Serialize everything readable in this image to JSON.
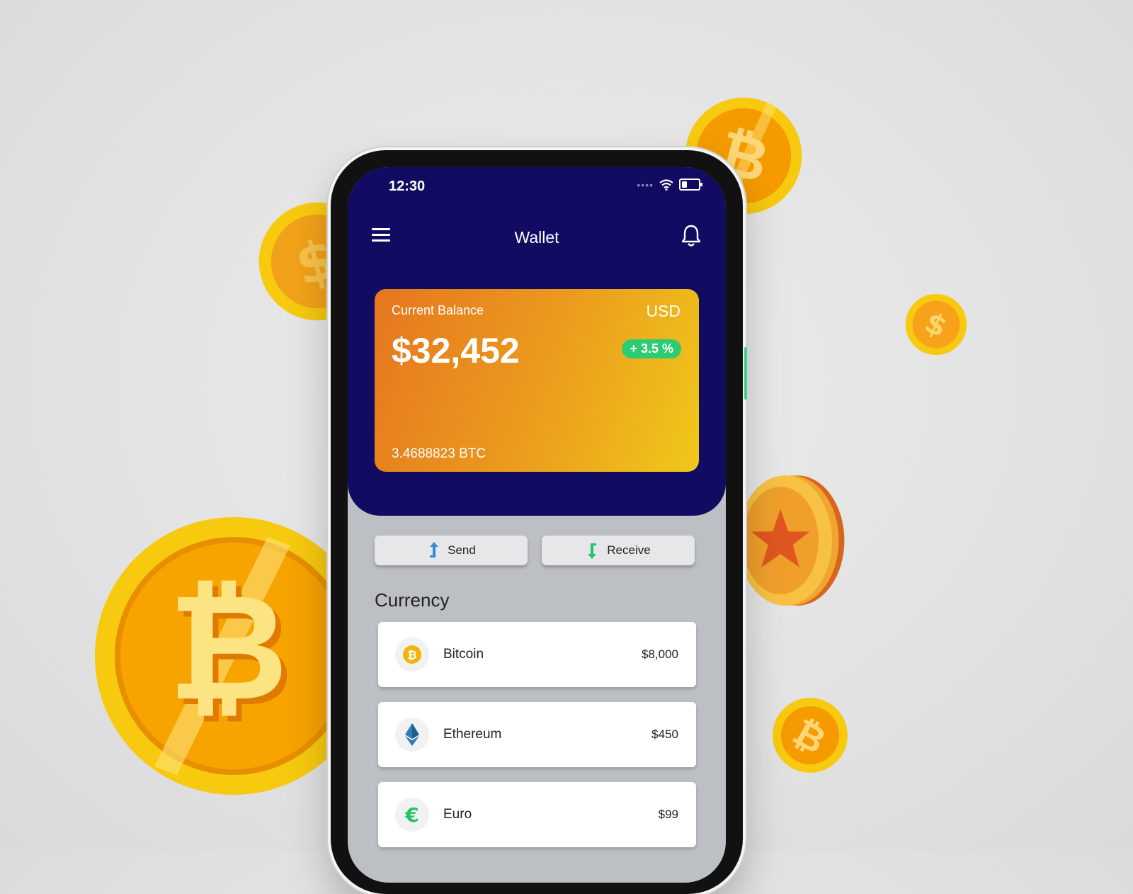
{
  "status_bar": {
    "time": "12:30"
  },
  "header": {
    "title": "Wallet"
  },
  "balance_card": {
    "label": "Current Balance",
    "currency": "USD",
    "amount": "$32,452",
    "change": "+ 3.5 %",
    "btc_amount": "3.4688823 BTC"
  },
  "actions": {
    "send_label": "Send",
    "receive_label": "Receive"
  },
  "currency_section": {
    "title": "Currency",
    "items": [
      {
        "name": "Bitcoin",
        "value": "$8,000",
        "icon": "bitcoin-icon"
      },
      {
        "name": "Ethereum",
        "value": "$450",
        "icon": "ethereum-icon"
      },
      {
        "name": "Euro",
        "value": "$99",
        "icon": "euro-icon"
      }
    ]
  },
  "colors": {
    "header_bg": "#120b62",
    "accent_green": "#2ecc71",
    "card_gradient_start": "#e6761f",
    "card_gradient_end": "#f0c81a",
    "coin_gold": "#f7b500"
  }
}
